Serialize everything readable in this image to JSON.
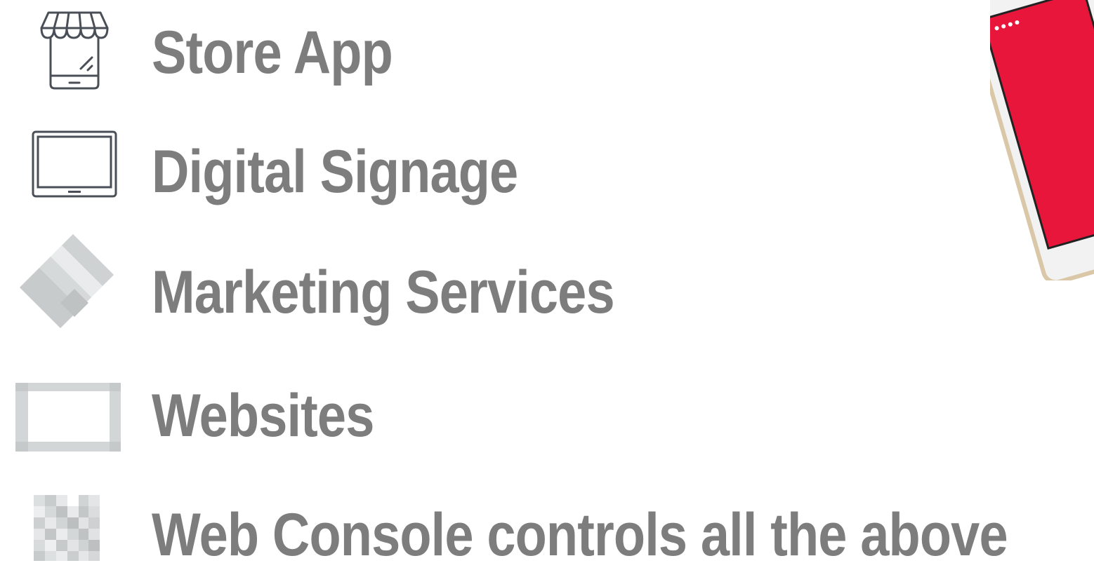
{
  "features": {
    "store_app": {
      "label": "Store App",
      "icon": "storefront-phone-icon"
    },
    "digital_signage": {
      "label": "Digital Signage",
      "icon": "monitor-icon"
    },
    "marketing_services": {
      "label": "Marketing Services",
      "icon": "diamond-tag-icon"
    },
    "websites": {
      "label": "Websites",
      "icon": "browser-window-icon"
    },
    "web_console": {
      "label": "Web Console controls all the above",
      "icon": "grid-console-icon"
    }
  },
  "colors": {
    "text": "#7d7d7d",
    "icon_dark": "#4a4f57",
    "icon_light": "#d0d3d4",
    "accent": "#e8163a"
  }
}
